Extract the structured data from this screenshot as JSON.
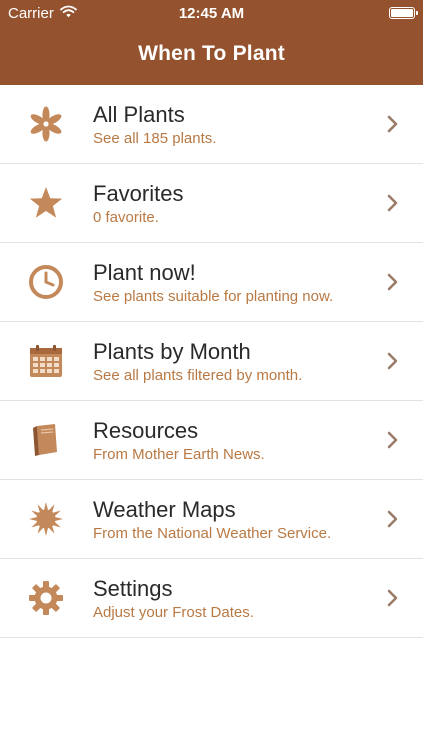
{
  "status": {
    "carrier": "Carrier",
    "time": "12:45 AM",
    "battery_level": 1.0
  },
  "nav": {
    "title": "When To Plant"
  },
  "colors": {
    "nav_bg": "#94532e",
    "accent": "#b87944",
    "icon": "#c4895a",
    "chevron": "#9a7c68"
  },
  "menu": {
    "items": [
      {
        "icon": "flower-icon",
        "title": "All Plants",
        "subtitle": "See all 185 plants."
      },
      {
        "icon": "star-icon",
        "title": "Favorites",
        "subtitle": "0 favorite."
      },
      {
        "icon": "clock-icon",
        "title": "Plant now!",
        "subtitle": "See plants suitable for planting now."
      },
      {
        "icon": "calendar-icon",
        "title": "Plants by Month",
        "subtitle": "See all plants filtered by month."
      },
      {
        "icon": "book-icon",
        "title": "Resources",
        "subtitle": "From Mother Earth News."
      },
      {
        "icon": "sun-icon",
        "title": "Weather Maps",
        "subtitle": "From the National Weather Service."
      },
      {
        "icon": "gear-icon",
        "title": "Settings",
        "subtitle": "Adjust your Frost Dates."
      }
    ]
  }
}
